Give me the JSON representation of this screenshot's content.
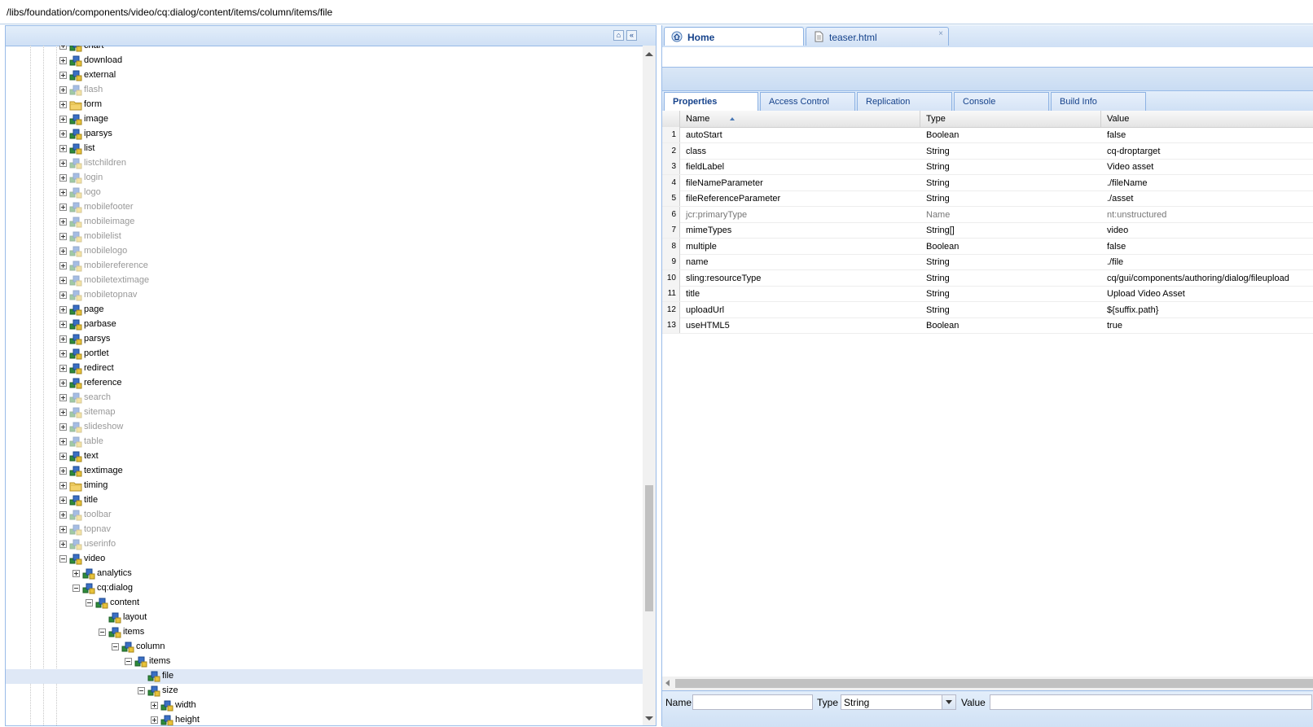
{
  "path": "/libs/foundation/components/video/cq:dialog/content/items/column/items/file",
  "tree": {
    "nodes": [
      {
        "label": "chart",
        "depth": 0,
        "toggle": "plus",
        "icon": "component",
        "dim": false,
        "clipped": true
      },
      {
        "label": "download",
        "depth": 0,
        "toggle": "plus",
        "icon": "component",
        "dim": false
      },
      {
        "label": "external",
        "depth": 0,
        "toggle": "plus",
        "icon": "component",
        "dim": false
      },
      {
        "label": "flash",
        "depth": 0,
        "toggle": "plus",
        "icon": "component",
        "dim": true
      },
      {
        "label": "form",
        "depth": 0,
        "toggle": "plus",
        "icon": "folder",
        "dim": false
      },
      {
        "label": "image",
        "depth": 0,
        "toggle": "plus",
        "icon": "component",
        "dim": false
      },
      {
        "label": "iparsys",
        "depth": 0,
        "toggle": "plus",
        "icon": "component",
        "dim": false
      },
      {
        "label": "list",
        "depth": 0,
        "toggle": "plus",
        "icon": "component",
        "dim": false
      },
      {
        "label": "listchildren",
        "depth": 0,
        "toggle": "plus",
        "icon": "component",
        "dim": true
      },
      {
        "label": "login",
        "depth": 0,
        "toggle": "plus",
        "icon": "component",
        "dim": true
      },
      {
        "label": "logo",
        "depth": 0,
        "toggle": "plus",
        "icon": "component",
        "dim": true
      },
      {
        "label": "mobilefooter",
        "depth": 0,
        "toggle": "plus",
        "icon": "component",
        "dim": true
      },
      {
        "label": "mobileimage",
        "depth": 0,
        "toggle": "plus",
        "icon": "component",
        "dim": true
      },
      {
        "label": "mobilelist",
        "depth": 0,
        "toggle": "plus",
        "icon": "component",
        "dim": true
      },
      {
        "label": "mobilelogo",
        "depth": 0,
        "toggle": "plus",
        "icon": "component",
        "dim": true
      },
      {
        "label": "mobilereference",
        "depth": 0,
        "toggle": "plus",
        "icon": "component",
        "dim": true
      },
      {
        "label": "mobiletextimage",
        "depth": 0,
        "toggle": "plus",
        "icon": "component",
        "dim": true
      },
      {
        "label": "mobiletopnav",
        "depth": 0,
        "toggle": "plus",
        "icon": "component",
        "dim": true
      },
      {
        "label": "page",
        "depth": 0,
        "toggle": "plus",
        "icon": "component",
        "dim": false
      },
      {
        "label": "parbase",
        "depth": 0,
        "toggle": "plus",
        "icon": "component",
        "dim": false
      },
      {
        "label": "parsys",
        "depth": 0,
        "toggle": "plus",
        "icon": "component",
        "dim": false
      },
      {
        "label": "portlet",
        "depth": 0,
        "toggle": "plus",
        "icon": "component",
        "dim": false
      },
      {
        "label": "redirect",
        "depth": 0,
        "toggle": "plus",
        "icon": "component",
        "dim": false
      },
      {
        "label": "reference",
        "depth": 0,
        "toggle": "plus",
        "icon": "component",
        "dim": false
      },
      {
        "label": "search",
        "depth": 0,
        "toggle": "plus",
        "icon": "component",
        "dim": true
      },
      {
        "label": "sitemap",
        "depth": 0,
        "toggle": "plus",
        "icon": "component",
        "dim": true
      },
      {
        "label": "slideshow",
        "depth": 0,
        "toggle": "plus",
        "icon": "component",
        "dim": true
      },
      {
        "label": "table",
        "depth": 0,
        "toggle": "plus",
        "icon": "component",
        "dim": true
      },
      {
        "label": "text",
        "depth": 0,
        "toggle": "plus",
        "icon": "component",
        "dim": false
      },
      {
        "label": "textimage",
        "depth": 0,
        "toggle": "plus",
        "icon": "component",
        "dim": false
      },
      {
        "label": "timing",
        "depth": 0,
        "toggle": "plus",
        "icon": "folder",
        "dim": false
      },
      {
        "label": "title",
        "depth": 0,
        "toggle": "plus",
        "icon": "component",
        "dim": false
      },
      {
        "label": "toolbar",
        "depth": 0,
        "toggle": "plus",
        "icon": "component",
        "dim": true
      },
      {
        "label": "topnav",
        "depth": 0,
        "toggle": "plus",
        "icon": "component",
        "dim": true
      },
      {
        "label": "userinfo",
        "depth": 0,
        "toggle": "plus",
        "icon": "component",
        "dim": true
      },
      {
        "label": "video",
        "depth": 0,
        "toggle": "minus",
        "icon": "component",
        "dim": false
      },
      {
        "label": "analytics",
        "depth": 1,
        "toggle": "plus",
        "icon": "component",
        "dim": false
      },
      {
        "label": "cq:dialog",
        "depth": 1,
        "toggle": "minus",
        "icon": "component",
        "dim": false
      },
      {
        "label": "content",
        "depth": 2,
        "toggle": "minus",
        "icon": "component",
        "dim": false
      },
      {
        "label": "layout",
        "depth": 3,
        "toggle": "none",
        "icon": "component",
        "dim": false
      },
      {
        "label": "items",
        "depth": 3,
        "toggle": "minus",
        "icon": "component",
        "dim": false
      },
      {
        "label": "column",
        "depth": 4,
        "toggle": "minus",
        "icon": "component",
        "dim": false
      },
      {
        "label": "items",
        "depth": 5,
        "toggle": "minus",
        "icon": "component",
        "dim": false
      },
      {
        "label": "file",
        "depth": 6,
        "toggle": "none",
        "icon": "component",
        "dim": false,
        "selected": true
      },
      {
        "label": "size",
        "depth": 6,
        "toggle": "minus",
        "icon": "component",
        "dim": false
      },
      {
        "label": "width",
        "depth": 7,
        "toggle": "plus",
        "icon": "component",
        "dim": false
      },
      {
        "label": "height",
        "depth": 7,
        "toggle": "plus",
        "icon": "component",
        "dim": false
      }
    ]
  },
  "top_tabs": [
    {
      "label": "Home",
      "icon": "home-icon",
      "active": true
    },
    {
      "label": "teaser.html",
      "icon": "file-icon",
      "active": false,
      "close": "×"
    }
  ],
  "prop_tabs": [
    {
      "label": "Properties",
      "active": true
    },
    {
      "label": "Access Control",
      "active": false
    },
    {
      "label": "Replication",
      "active": false
    },
    {
      "label": "Console",
      "active": false
    },
    {
      "label": "Build Info",
      "active": false
    }
  ],
  "grid": {
    "columns": [
      "Name",
      "Type",
      "Value"
    ],
    "sorted_column": "Name",
    "rows": [
      {
        "n": "1",
        "name": "autoStart",
        "type": "Boolean",
        "value": "false"
      },
      {
        "n": "2",
        "name": "class",
        "type": "String",
        "value": "cq-droptarget"
      },
      {
        "n": "3",
        "name": "fieldLabel",
        "type": "String",
        "value": "Video asset"
      },
      {
        "n": "4",
        "name": "fileNameParameter",
        "type": "String",
        "value": "./fileName"
      },
      {
        "n": "5",
        "name": "fileReferenceParameter",
        "type": "String",
        "value": "./asset"
      },
      {
        "n": "6",
        "name": "jcr:primaryType",
        "type": "Name",
        "value": "nt:unstructured",
        "dim": true
      },
      {
        "n": "7",
        "name": "mimeTypes",
        "type": "String[]",
        "value": "video"
      },
      {
        "n": "8",
        "name": "multiple",
        "type": "Boolean",
        "value": "false"
      },
      {
        "n": "9",
        "name": "name",
        "type": "String",
        "value": "./file"
      },
      {
        "n": "10",
        "name": "sling:resourceType",
        "type": "String",
        "value": "cq/gui/components/authoring/dialog/fileupload"
      },
      {
        "n": "11",
        "name": "title",
        "type": "String",
        "value": "Upload Video Asset"
      },
      {
        "n": "12",
        "name": "uploadUrl",
        "type": "String",
        "value": "${suffix.path}"
      },
      {
        "n": "13",
        "name": "useHTML5",
        "type": "Boolean",
        "value": "true"
      }
    ]
  },
  "editor": {
    "name_label": "Name",
    "name_value": "",
    "type_label": "Type",
    "type_value": "String",
    "value_label": "Value",
    "value_value": ""
  },
  "colors": {
    "accent": "#15428b",
    "border": "#99bbe8",
    "selection": "#dfe8f6"
  }
}
